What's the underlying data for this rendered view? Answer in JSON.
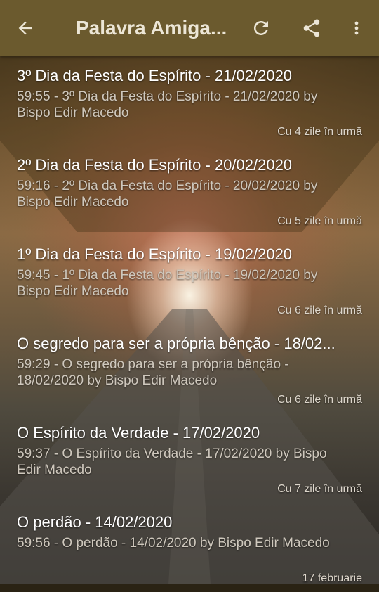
{
  "header": {
    "title": "Palavra Amiga...",
    "back_icon": "arrow-back-icon",
    "refresh_icon": "refresh-icon",
    "share_icon": "share-icon",
    "menu_icon": "more-vert-icon",
    "color": "#6b5a2e"
  },
  "episodes": [
    {
      "title": "3º Dia da Festa do Espírito - 21/02/2020",
      "description": "59:55 - 3º Dia da Festa do Espírito - 21/02/2020 by Bispo Edir Macedo",
      "age": "Cu 4 zile în urmă"
    },
    {
      "title": "2º Dia da Festa do Espírito - 20/02/2020",
      "description": "59:16 - 2º Dia da Festa do Espírito - 20/02/2020 by Bispo Edir Macedo",
      "age": "Cu 5 zile în urmă"
    },
    {
      "title": "1º Dia da Festa do Espírito - 19/02/2020",
      "description": "59:45 - 1º Dia da Festa do Espírito - 19/02/2020 by Bispo Edir Macedo",
      "age": "Cu 6 zile în urmă"
    },
    {
      "title": "O segredo para ser a própria bênção - 18/02...",
      "description": "59:29 - O segredo para ser a própria bênção - 18/02/2020 by Bispo Edir Macedo",
      "age": "Cu 6 zile în urmă"
    },
    {
      "title": "O Espírito da Verdade - 17/02/2020",
      "description": "59:37 - O Espírito da Verdade - 17/02/2020 by Bispo Edir Macedo",
      "age": "Cu 7 zile în urmă"
    },
    {
      "title": "O perdão - 14/02/2020",
      "description": "59:56 - O perdão - 14/02/2020 by Bispo Edir Macedo",
      "age": "17 februarie"
    }
  ]
}
